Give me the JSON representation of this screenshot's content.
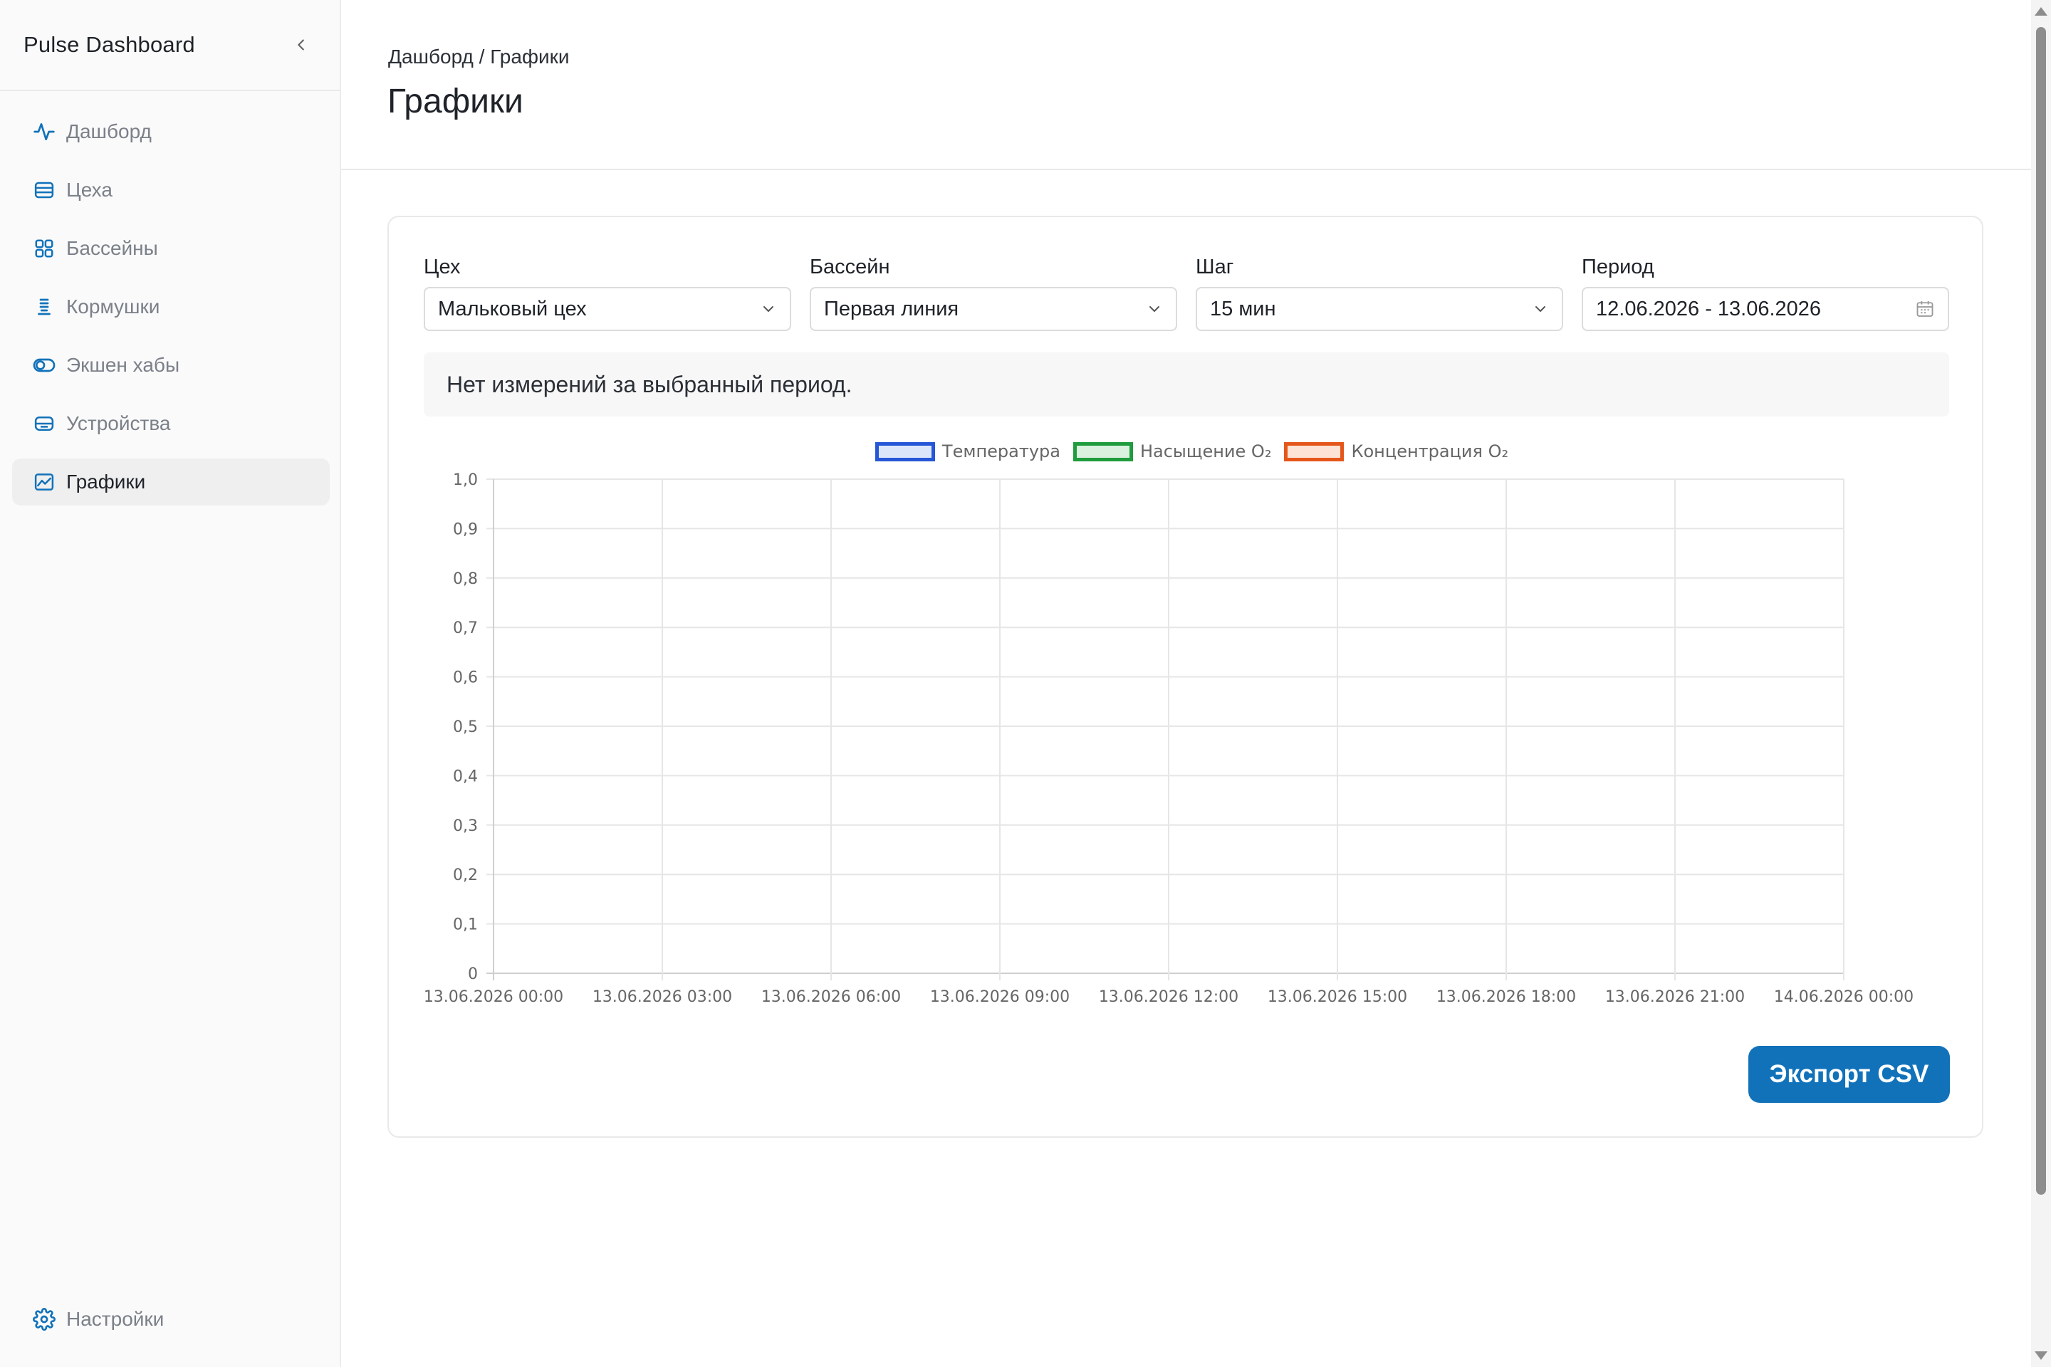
{
  "app": {
    "title": "Pulse Dashboard"
  },
  "sidebar": {
    "items": [
      {
        "label": "Дашборд",
        "icon": "activity-icon"
      },
      {
        "label": "Цеха",
        "icon": "stack-icon"
      },
      {
        "label": "Бассейны",
        "icon": "grid-icon"
      },
      {
        "label": "Кормушки",
        "icon": "feeder-icon"
      },
      {
        "label": "Экшен хабы",
        "icon": "toggle-icon"
      },
      {
        "label": "Устройства",
        "icon": "device-icon"
      },
      {
        "label": "Графики",
        "icon": "chart-icon",
        "active": true
      }
    ],
    "settings": {
      "label": "Настройки",
      "icon": "gear-icon"
    }
  },
  "header": {
    "breadcrumb": "Дашборд / Графики",
    "title": "Графики"
  },
  "filters": {
    "workshop": {
      "label": "Цех",
      "value": "Мальковый цех"
    },
    "pool": {
      "label": "Бассейн",
      "value": "Первая линия"
    },
    "step": {
      "label": "Шаг",
      "value": "15 мин"
    },
    "period": {
      "label": "Период",
      "value": "12.06.2026 - 13.06.2026"
    }
  },
  "empty_message": "Нет измерений за выбранный период.",
  "export_label": "Экспорт CSV",
  "colors": {
    "accent": "#1172ba",
    "temperature": "#2557d6",
    "saturation": "#1f9d3e",
    "concentration": "#e5561a"
  },
  "chart_data": {
    "type": "line",
    "title": "",
    "xlabel": "",
    "ylabel": "",
    "categories": [
      "13.06.2026 00:00",
      "13.06.2026 03:00",
      "13.06.2026 06:00",
      "13.06.2026 09:00",
      "13.06.2026 12:00",
      "13.06.2026 15:00",
      "13.06.2026 18:00",
      "13.06.2026 21:00",
      "14.06.2026 00:00"
    ],
    "y_ticks": [
      "0",
      "0,1",
      "0,2",
      "0,3",
      "0,4",
      "0,5",
      "0,6",
      "0,7",
      "0,8",
      "0,9",
      "1,0"
    ],
    "ylim": [
      0,
      1
    ],
    "grid": true,
    "legend_position": "top",
    "series": [
      {
        "name": "Температура",
        "color": "#2557d6",
        "fill": "#dce6fb",
        "values": []
      },
      {
        "name": "Насыщение O₂",
        "color": "#1f9d3e",
        "fill": "#d9f1de",
        "values": []
      },
      {
        "name": "Концентрация O₂",
        "color": "#e5561a",
        "fill": "#fde3d6",
        "values": []
      }
    ]
  }
}
